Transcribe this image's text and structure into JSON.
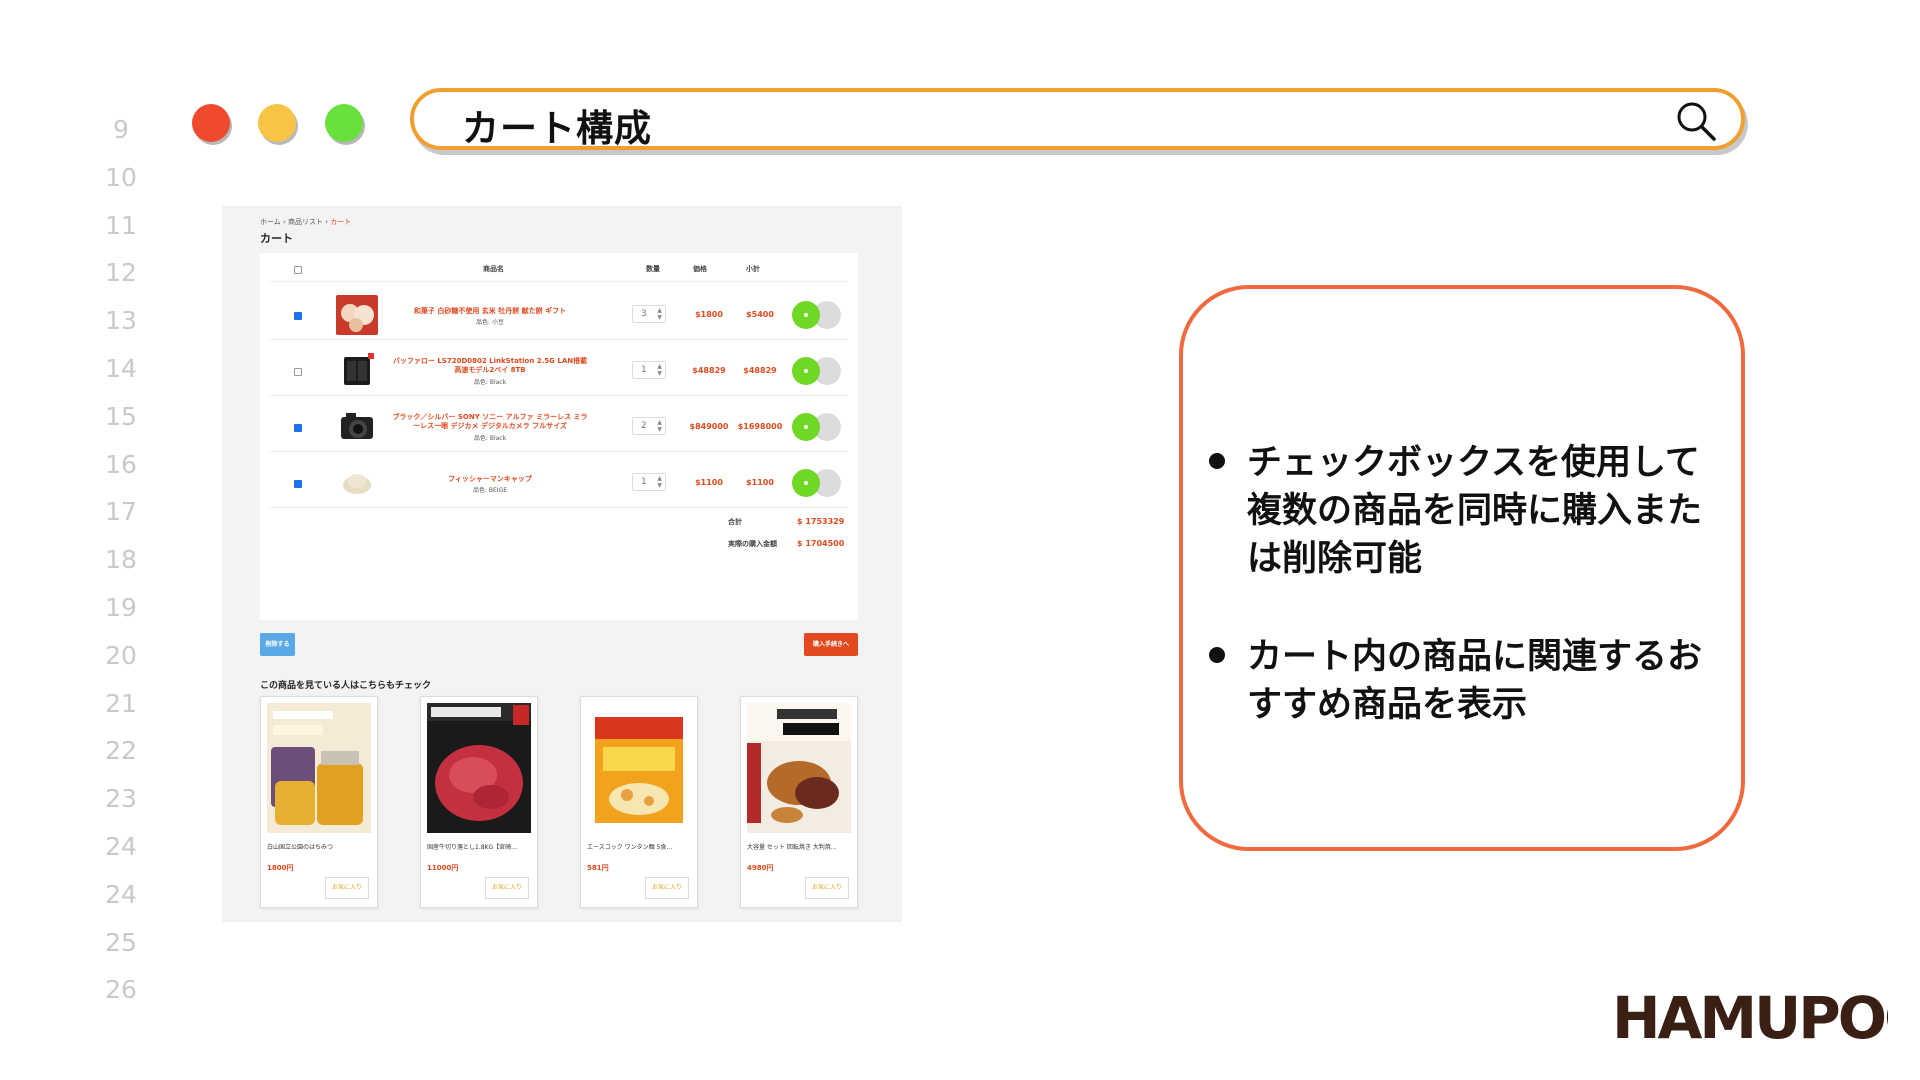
{
  "line_numbers": [
    "9",
    "10",
    "11",
    "12",
    "13",
    "14",
    "15",
    "16",
    "17",
    "18",
    "19",
    "20",
    "21",
    "22",
    "23",
    "24",
    "24",
    "25",
    "26"
  ],
  "window": {
    "title": "カート構成",
    "dots": {
      "red": "#f04a2e",
      "yellow": "#f8c446",
      "green": "#6ae03c"
    },
    "search_icon": "search-icon"
  },
  "cart": {
    "breadcrumb": {
      "home": "ホーム",
      "list": "商品リスト",
      "current": "カート"
    },
    "title": "カート",
    "headers": {
      "name": "商品名",
      "qty": "数量",
      "price": "価格",
      "subtotal": "小計"
    },
    "items": [
      {
        "checked": true,
        "name": "和菓子 白砂糖不使用 玄米 牡丹餅 献た餅 ギフト",
        "variant": "品色: 小豆",
        "qty": "3",
        "price": "$1800",
        "subtotal": "$5400"
      },
      {
        "checked": false,
        "name": "バッファロー LS720D0802 LinkStation 2.5G LAN搭載高速モデル2ベイ 8TB",
        "variant": "品色: Black",
        "qty": "1",
        "price": "$48829",
        "subtotal": "$48829"
      },
      {
        "checked": true,
        "name": "ブラック／シルバー SONY ソニー アルファ ミラーレス ミラーレス一眼 デジカメ デジタルカメラ フルサイズ",
        "variant": "品色: Black",
        "qty": "2",
        "price": "$849000",
        "subtotal": "$1698000"
      },
      {
        "checked": true,
        "name": "フィッシャーマンキャップ",
        "variant": "品色: BEIGE",
        "qty": "1",
        "price": "$1100",
        "subtotal": "$1100"
      }
    ],
    "total_label": "合計",
    "total_value": "$ 1753329",
    "actual_label": "実際の購入金額",
    "actual_value": "$ 1704500",
    "delete_label": "削除する",
    "buy_label": "購入手続きへ"
  },
  "recommend": {
    "title": "この商品を見ている人はこちらもチェック",
    "fav_label": "お気に入り",
    "items": [
      {
        "name": "白山国立公園のはちみつ",
        "price": "1800円"
      },
      {
        "name": "国産牛切り落とし1.8KG【宮崎…",
        "price": "11000円"
      },
      {
        "name": "エースコック ワンタン麺 5食…",
        "price": "581円"
      },
      {
        "name": "大容量 セット 回転焼き 大判焼…",
        "price": "4980円"
      }
    ]
  },
  "info": {
    "bullets": [
      "チェックボックスを使用して複数の商品を同時に購入または削除可能",
      "カート内の商品に関連するおすすめ商品を表示"
    ]
  },
  "logo_text": "HAMUPOCHI",
  "colors": {
    "accent": "#e04a1e",
    "search_border": "#f0a030",
    "card_border": "#ef6a3e",
    "cart_green": "#6fd824"
  }
}
